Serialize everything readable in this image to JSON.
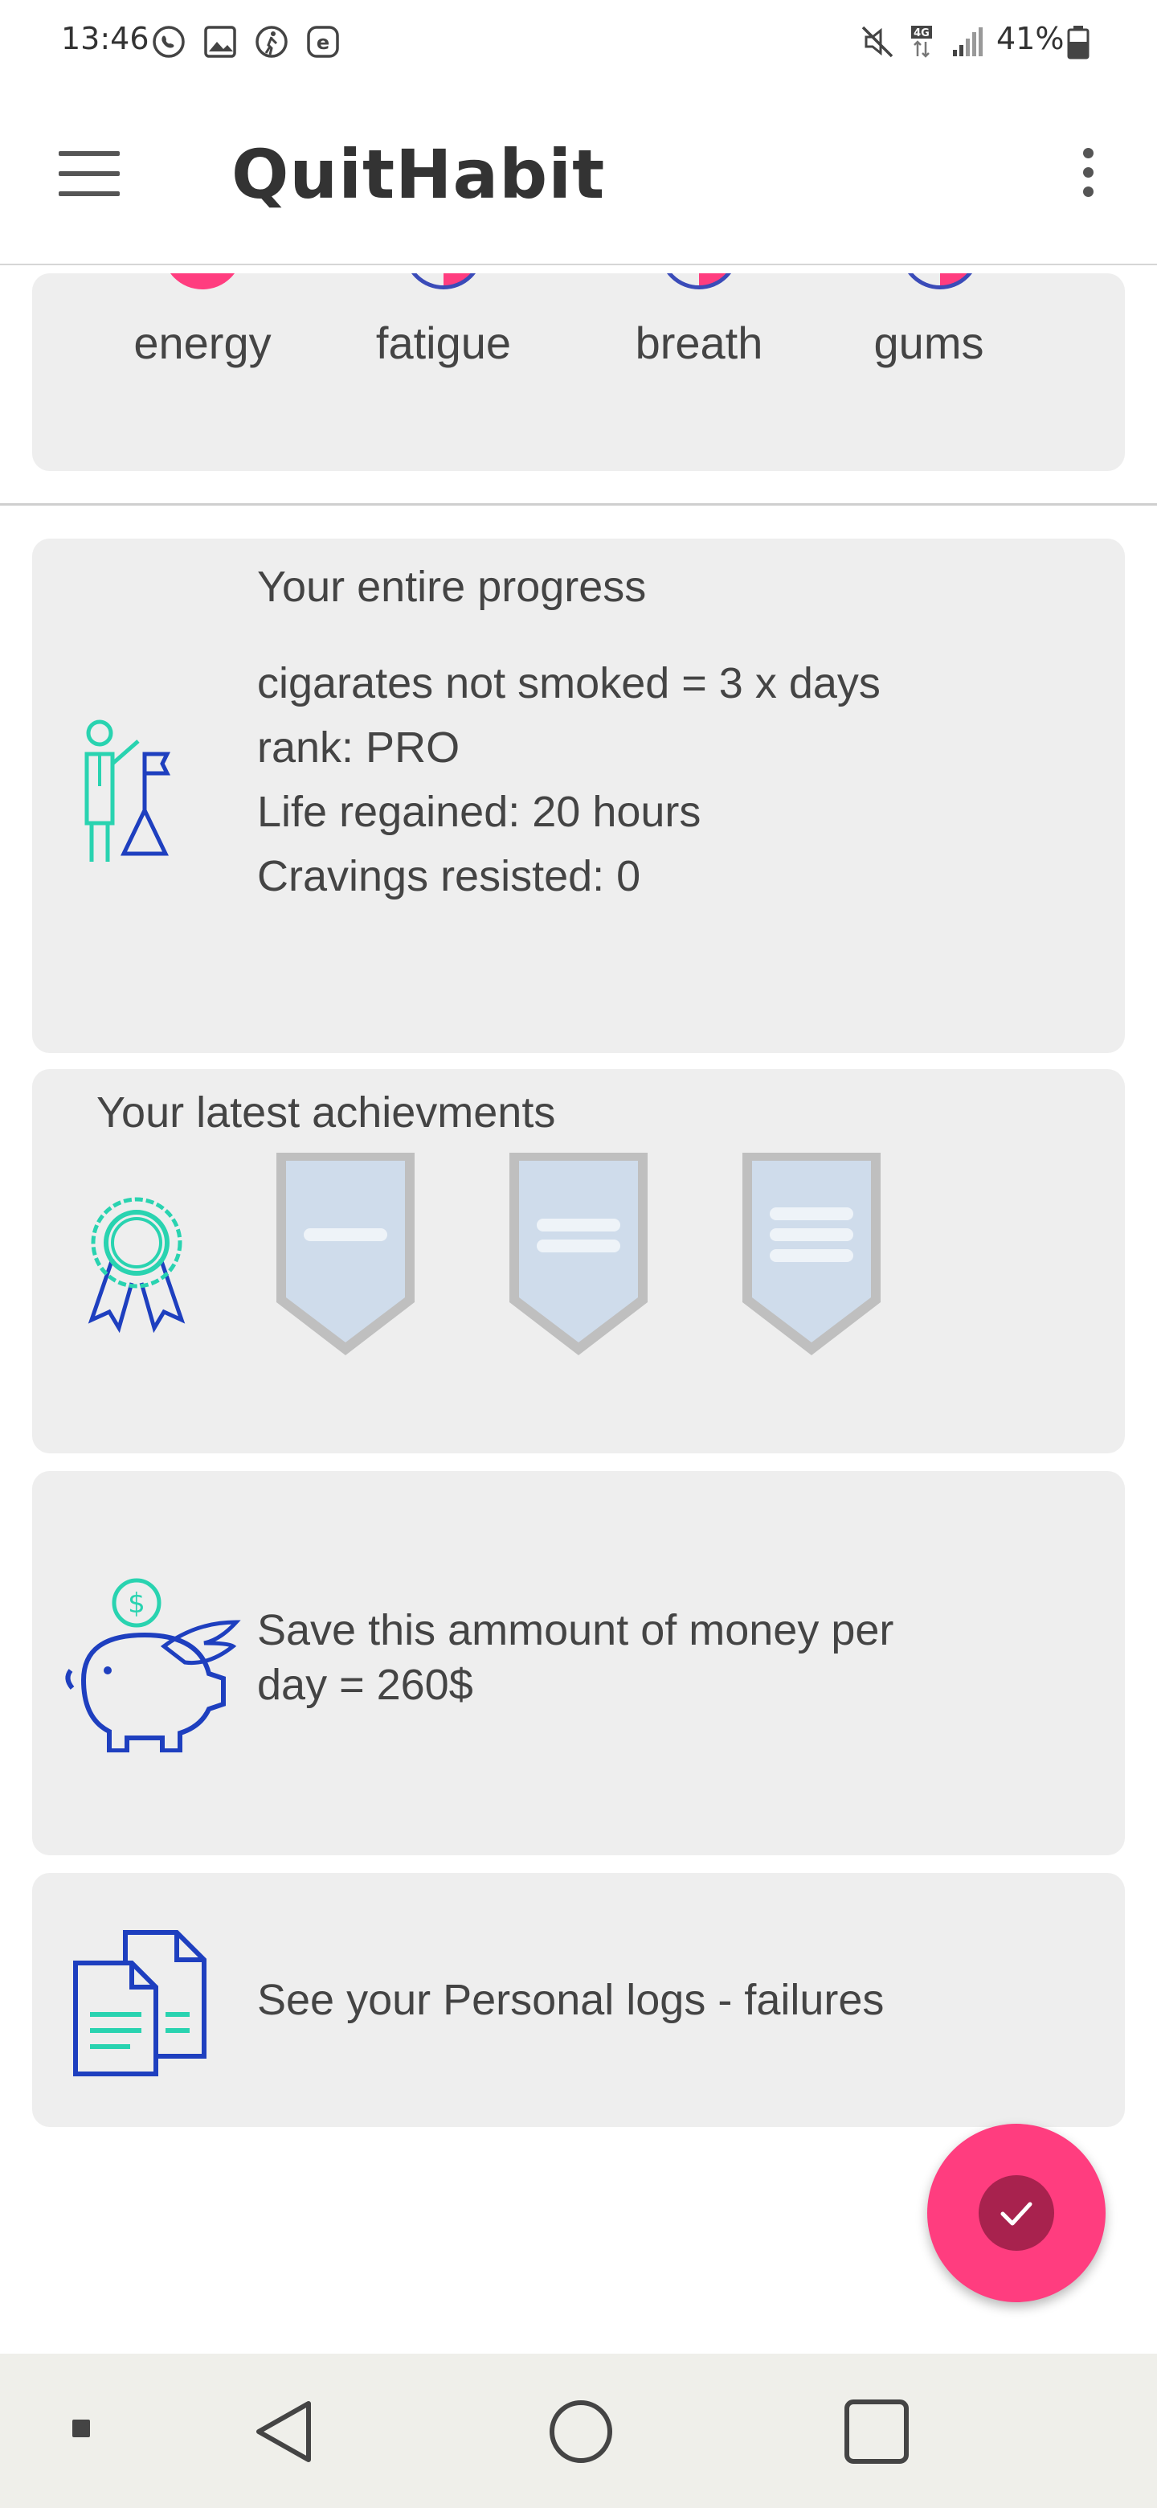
{
  "status_bar": {
    "time": "13:46",
    "battery": "41%",
    "network": "4G"
  },
  "app_bar": {
    "title": "QuitHabit"
  },
  "symptoms": {
    "labels": [
      "energy",
      "fatigue",
      "breath",
      "gums"
    ]
  },
  "progress": {
    "title": "Your entire progress",
    "lines": [
      "cigarates not smoked = 3 x days",
      "rank: PRO",
      "Life regained: 20 hours",
      "Cravings resisted: 0"
    ]
  },
  "achievements": {
    "title": "Your latest achievments"
  },
  "money": {
    "line1": "Save this ammount of money per",
    "line2": "day = 260$",
    "icon_symbol": "$"
  },
  "logs": {
    "text": "See your Personal logs - failures"
  },
  "colors": {
    "accent": "#ff3d7f",
    "fab_inner": "#a8224e",
    "card_bg": "#eeeeee",
    "icon_blue": "#1e3fbf",
    "icon_teal": "#29d3b0"
  }
}
